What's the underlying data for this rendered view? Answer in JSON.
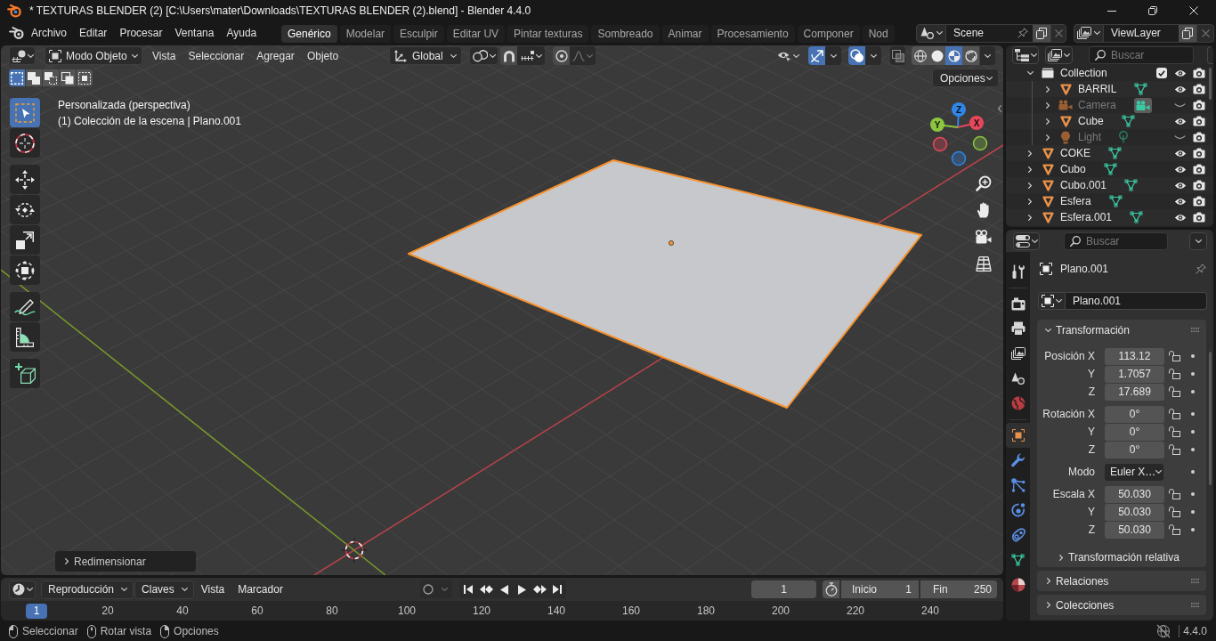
{
  "title_bar": {
    "title": "* TEXTURAS BLENDER (2) [C:\\Users\\mater\\Downloads\\TEXTURAS BLENDER (2).blend] - Blender 4.4.0"
  },
  "top_bar": {
    "menus": [
      "Archivo",
      "Editar",
      "Procesar",
      "Ventana",
      "Ayuda"
    ],
    "workspaces": [
      {
        "label": "Genérico",
        "selected": true
      },
      {
        "label": "Modelar",
        "selected": false
      },
      {
        "label": "Esculpir",
        "selected": false
      },
      {
        "label": "Editar UV",
        "selected": false
      },
      {
        "label": "Pintar texturas",
        "selected": false
      },
      {
        "label": "Sombreado",
        "selected": false
      },
      {
        "label": "Animar",
        "selected": false
      },
      {
        "label": "Procesamiento",
        "selected": false
      },
      {
        "label": "Componer",
        "selected": false
      },
      {
        "label": "Nod",
        "selected": false
      }
    ],
    "scene": "Scene",
    "view_layer": "ViewLayer"
  },
  "viewport": {
    "header": {
      "mode": "Modo Objeto",
      "menus": [
        "Vista",
        "Seleccionar",
        "Agregar",
        "Objeto"
      ],
      "orientation": "Global",
      "snap": false,
      "proportional_editing": false,
      "gizmos": true,
      "overlays": true,
      "xray": false,
      "shading": [
        {
          "kind": "wireframe",
          "selected": false
        },
        {
          "kind": "solid",
          "selected": false
        },
        {
          "kind": "material",
          "selected": true
        },
        {
          "kind": "rendered",
          "selected": false
        }
      ]
    },
    "selection_modes": [
      {
        "kind": "set",
        "selected": true
      },
      {
        "kind": "extend",
        "selected": false
      },
      {
        "kind": "subtract",
        "selected": false
      },
      {
        "kind": "invert",
        "selected": false
      },
      {
        "kind": "intersect",
        "selected": false
      }
    ],
    "options": "Opciones",
    "tool_groups": [
      [
        {
          "kind": "select",
          "selected": true
        },
        {
          "kind": "cursor",
          "selected": false
        }
      ],
      [
        {
          "kind": "move",
          "selected": false
        },
        {
          "kind": "rotate",
          "selected": false
        },
        {
          "kind": "scale",
          "selected": false
        },
        {
          "kind": "transform",
          "selected": false
        }
      ],
      [
        {
          "kind": "annotate",
          "selected": false
        },
        {
          "kind": "measure",
          "selected": false
        }
      ],
      [
        {
          "kind": "add",
          "selected": false
        }
      ]
    ],
    "view_name": "Personalizada (perspectiva)",
    "view_info": "(1) Colección de la escena | Plano.001",
    "object_selected": true,
    "gizmo_axes": [
      {
        "label": "Z",
        "color": "#2f86e8"
      },
      {
        "label": "Y",
        "color": "#8cc63f"
      },
      {
        "label": "X",
        "color": "#e8475b"
      }
    ],
    "last_operator": {
      "label": "Redimensionar",
      "expanded": false
    }
  },
  "outliner": {
    "search_placeholder": "Buscar",
    "rows": [
      {
        "name": "Collection",
        "kind": "collection",
        "expanded": true,
        "checked": true,
        "visible": true,
        "children": [
          {
            "name": "BARRIL",
            "kind": "mesh",
            "expanded": false,
            "visible": true
          },
          {
            "name": "Camera",
            "kind": "camera",
            "expanded": false,
            "visible": false
          },
          {
            "name": "Cube",
            "kind": "mesh",
            "expanded": false,
            "visible": true
          },
          {
            "name": "Light",
            "kind": "light",
            "expanded": false,
            "visible": false
          }
        ]
      },
      {
        "name": "COKE",
        "kind": "mesh",
        "expanded": false,
        "visible": true
      },
      {
        "name": "Cubo",
        "kind": "mesh",
        "expanded": false,
        "visible": true
      },
      {
        "name": "Cubo.001",
        "kind": "mesh",
        "expanded": false,
        "visible": true
      },
      {
        "name": "Esfera",
        "kind": "mesh",
        "expanded": false,
        "visible": true
      },
      {
        "name": "Esfera.001",
        "kind": "mesh",
        "expanded": false,
        "visible": true
      }
    ]
  },
  "properties": {
    "search_placeholder": "Buscar",
    "tabs": [
      {
        "kind": "tool",
        "selected": false
      },
      {
        "kind": "render",
        "selected": false
      },
      {
        "kind": "output",
        "selected": false
      },
      {
        "kind": "view_layer",
        "selected": false
      },
      {
        "kind": "scene",
        "selected": false
      },
      {
        "kind": "world",
        "selected": false
      },
      {
        "kind": "object",
        "selected": true
      },
      {
        "kind": "modifiers",
        "selected": false
      },
      {
        "kind": "particles",
        "selected": false
      },
      {
        "kind": "physics",
        "selected": false
      },
      {
        "kind": "constraints",
        "selected": false
      },
      {
        "kind": "data",
        "selected": false
      },
      {
        "kind": "material",
        "selected": false
      }
    ],
    "object_name": "Plano.001",
    "name_field": "Plano.001",
    "transform": {
      "title": "Transformación",
      "expanded": true,
      "groups": [
        [
          {
            "label": "Posición X",
            "value": "113.12",
            "kind": "number",
            "locked": false
          },
          {
            "label": "Y",
            "value": "1.7057",
            "kind": "number",
            "locked": false
          },
          {
            "label": "Z",
            "value": "17.689",
            "kind": "number",
            "locked": false
          }
        ],
        [
          {
            "label": "Rotación X",
            "value": "0°",
            "kind": "number",
            "locked": false
          },
          {
            "label": "Y",
            "value": "0°",
            "kind": "number",
            "locked": false
          },
          {
            "label": "Z",
            "value": "0°",
            "kind": "number",
            "locked": false
          }
        ],
        [
          {
            "label": "Modo",
            "value": "Euler X…",
            "kind": "dropdown"
          }
        ],
        [
          {
            "label": "Escala X",
            "value": "50.030",
            "kind": "number",
            "locked": false
          },
          {
            "label": "Y",
            "value": "50.030",
            "kind": "number",
            "locked": false
          },
          {
            "label": "Z",
            "value": "50.030",
            "kind": "number",
            "locked": false
          }
        ]
      ],
      "subpanel": {
        "title": "Transformación relativa",
        "expanded": false
      }
    },
    "panels": [
      {
        "title": "Relaciones",
        "expanded": false
      },
      {
        "title": "Colecciones",
        "expanded": false
      }
    ]
  },
  "timeline": {
    "menus": [
      {
        "label": "Reproducción",
        "kind": "dropdown"
      },
      {
        "label": "Claves",
        "kind": "dropdown"
      },
      {
        "label": "Vista",
        "kind": "menu"
      },
      {
        "label": "Marcador",
        "kind": "menu"
      }
    ],
    "auto_keying": false,
    "current_frame": "1",
    "start": {
      "label": "Inicio",
      "value": "1"
    },
    "end": {
      "label": "Fin",
      "value": "250"
    },
    "ruler": [
      {
        "label": "1",
        "selected": true
      },
      {
        "label": "20",
        "selected": false
      },
      {
        "label": "40",
        "selected": false
      },
      {
        "label": "60",
        "selected": false
      },
      {
        "label": "80",
        "selected": false
      },
      {
        "label": "100",
        "selected": false
      },
      {
        "label": "120",
        "selected": false
      },
      {
        "label": "140",
        "selected": false
      },
      {
        "label": "160",
        "selected": false
      },
      {
        "label": "180",
        "selected": false
      },
      {
        "label": "200",
        "selected": false
      },
      {
        "label": "220",
        "selected": false
      },
      {
        "label": "240",
        "selected": false
      }
    ]
  },
  "status_bar": {
    "hints": [
      {
        "kind": "left",
        "label": "Seleccionar"
      },
      {
        "kind": "middle",
        "label": "Rotar vista"
      },
      {
        "kind": "right",
        "label": "Opciones"
      }
    ],
    "version": "4.4.0"
  }
}
